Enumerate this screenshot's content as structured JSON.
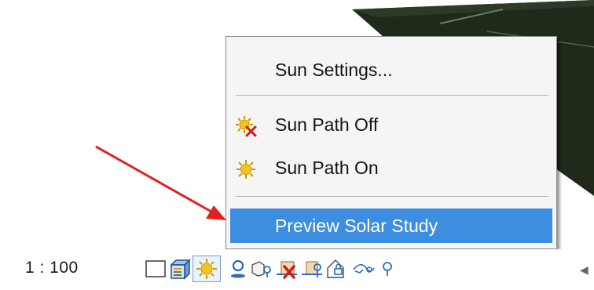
{
  "menu": {
    "items": [
      {
        "label": "Sun Settings...",
        "icon": "none"
      },
      {
        "label": "Sun Path Off",
        "icon": "sun-off-icon"
      },
      {
        "label": "Sun Path On",
        "icon": "sun-icon"
      },
      {
        "label": "Preview Solar Study",
        "icon": "none",
        "highlighted": true
      }
    ]
  },
  "statusbar": {
    "scale": "1 : 100",
    "tools": [
      "detail-level-icon",
      "visual-style-icon",
      "sun-path-icon",
      "shadows-icon",
      "crop-view-icon",
      "hide-crop-region-icon",
      "temporary-hide-icon",
      "reveal-hidden-icon",
      "unlock-3d-view-icon",
      "hide-analytical-icon",
      "scroll-left-icon"
    ]
  },
  "colors": {
    "highlight": "#3d8ee0",
    "annotation_arrow": "#e32020",
    "sun_yellow": "#f6c21d"
  }
}
